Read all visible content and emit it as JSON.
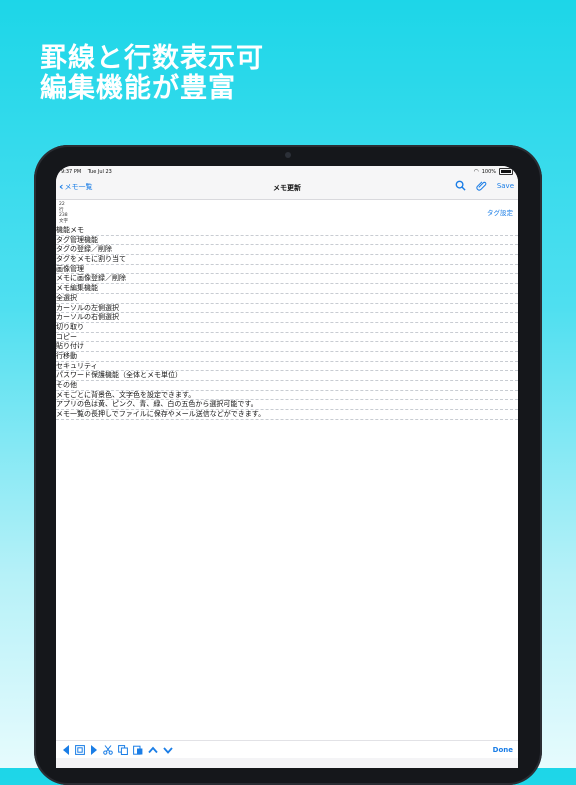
{
  "promo": {
    "line1": "罫線と行数表示可",
    "line2": "編集機能が豊富"
  },
  "status": {
    "time": "9:37 PM",
    "date": "Tue Jul 23",
    "battery": "100%"
  },
  "nav": {
    "back_label": "メモ一覧",
    "title": "メモ更新",
    "save_label": "Save"
  },
  "counts": {
    "chars": "22",
    "lines_label": "行",
    "total": "238",
    "unit": "文字"
  },
  "tag_settings": "タグ設定",
  "memo_lines": [
    "機能メモ",
    "タグ管理機能",
    "  タグの登録／削除",
    "  タグをメモに割り当て",
    "画像管理",
    "  メモに画像登録／削除",
    "メモ編集機能",
    "  全選択",
    "  カーソルの左側選択",
    "  カーソルの右側選択",
    "  切り取り",
    "  コピー",
    "  貼り付け",
    "  行移動",
    "セキュリティ",
    "  パスワード保護機能（全体とメモ単位）",
    "その他",
    "  メモごとに背景色、文字色を設定できます。",
    "  アプリの色は黄、ピンク、青、緑、白の五色から選択可能です。",
    "  メモ一覧の長押しでファイルに保存やメール送信などができます。"
  ],
  "toolbar": {
    "done_label": "Done"
  },
  "colors": {
    "accent": "#1a7de6",
    "background_top": "#1dd6e8"
  }
}
